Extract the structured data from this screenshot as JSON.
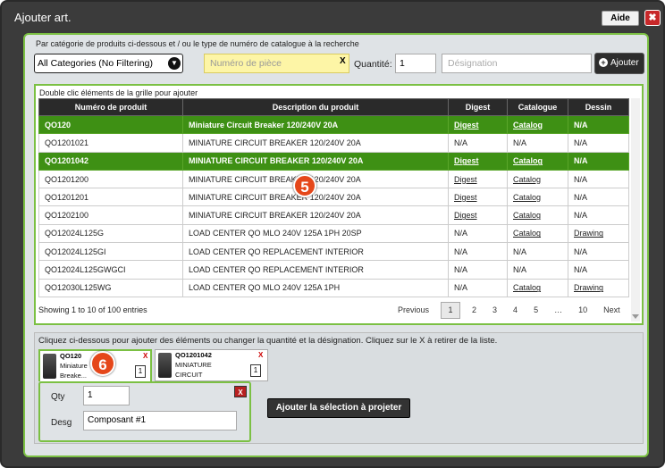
{
  "window": {
    "title": "Ajouter art.",
    "help_label": "Aide",
    "close_label": "✖"
  },
  "search": {
    "instruction": "Par catégorie de produits ci-dessous et / ou le type de numéro de catalogue à la recherche",
    "category_selected": "All Categories (No Filtering)",
    "part_placeholder": "Numéro de pièce",
    "part_clear": "X",
    "qty_label": "Quantité:",
    "qty_value": "1",
    "designation_placeholder": "Désignation",
    "add_label": "Ajouter",
    "add_icon": "+"
  },
  "grid": {
    "hint": "Double clic éléments de la grille pour ajouter",
    "columns": [
      "Numéro de produit",
      "Description du produit",
      "Digest",
      "Catalogue",
      "Dessin"
    ],
    "rows": [
      {
        "num": "QO120",
        "desc": "Miniature Circuit Breaker 120/240V 20A",
        "digest": "Digest",
        "catalog": "Catalog",
        "drawing": "N/A",
        "selected": true
      },
      {
        "num": "QO1201021",
        "desc": "MINIATURE CIRCUIT BREAKER 120/240V 20A",
        "digest": "N/A",
        "catalog": "N/A",
        "drawing": "N/A",
        "selected": false
      },
      {
        "num": "QO1201042",
        "desc": "MINIATURE CIRCUIT BREAKER 120/240V 20A",
        "digest": "Digest",
        "catalog": "Catalog",
        "drawing": "N/A",
        "selected": true
      },
      {
        "num": "QO1201200",
        "desc": "MINIATURE CIRCUIT BREAKER 120/240V 20A",
        "digest": "Digest",
        "catalog": "Catalog",
        "drawing": "N/A",
        "selected": false
      },
      {
        "num": "QO1201201",
        "desc": "MINIATURE CIRCUIT BREAKER 120/240V 20A",
        "digest": "Digest",
        "catalog": "Catalog",
        "drawing": "N/A",
        "selected": false
      },
      {
        "num": "QO1202100",
        "desc": "MINIATURE CIRCUIT BREAKER 120/240V 20A",
        "digest": "Digest",
        "catalog": "Catalog",
        "drawing": "N/A",
        "selected": false
      },
      {
        "num": "QO12024L125G",
        "desc": "LOAD CENTER QO MLO 240V 125A 1PH 20SP",
        "digest": "N/A",
        "catalog": "Catalog",
        "drawing": "Drawing",
        "selected": false
      },
      {
        "num": "QO12024L125GI",
        "desc": "LOAD CENTER QO REPLACEMENT INTERIOR",
        "digest": "N/A",
        "catalog": "N/A",
        "drawing": "N/A",
        "selected": false
      },
      {
        "num": "QO12024L125GWGCI",
        "desc": "LOAD CENTER QO REPLACEMENT INTERIOR",
        "digest": "N/A",
        "catalog": "N/A",
        "drawing": "N/A",
        "selected": false
      },
      {
        "num": "QO12030L125WG",
        "desc": "LOAD CENTER QO MLO 240V 125A 1PH",
        "digest": "N/A",
        "catalog": "Catalog",
        "drawing": "Drawing",
        "selected": false
      }
    ],
    "info": "Showing 1 to 10 of 100 entries",
    "pager": {
      "previous": "Previous",
      "pages": [
        "1",
        "2",
        "3",
        "4",
        "5",
        "…",
        "10"
      ],
      "next": "Next"
    }
  },
  "selection": {
    "hint": "Cliquez ci-dessous pour ajouter des éléments ou changer la quantité et la désignation. Cliquez sur le X à retirer de la liste.",
    "items": [
      {
        "code": "QO120",
        "desc": "Miniature Breake...",
        "qty": "1",
        "remove": "X"
      },
      {
        "code": "QO1201042",
        "desc": "MINIATURE CIRCUIT BREAKE...",
        "qty": "1",
        "remove": "X"
      }
    ],
    "edit": {
      "qty_label": "Qty",
      "qty_value": "1",
      "desg_label": "Desg",
      "desg_value": "Composant #1",
      "remove": "X"
    },
    "project_button": "Ajouter la sélection à projeter"
  },
  "badges": {
    "grid": "5",
    "selection": "6"
  },
  "colors": {
    "accent": "#7bc043",
    "selected_row": "#3e9014",
    "frame": "#3b3b3b",
    "badge": "#e5471a"
  }
}
